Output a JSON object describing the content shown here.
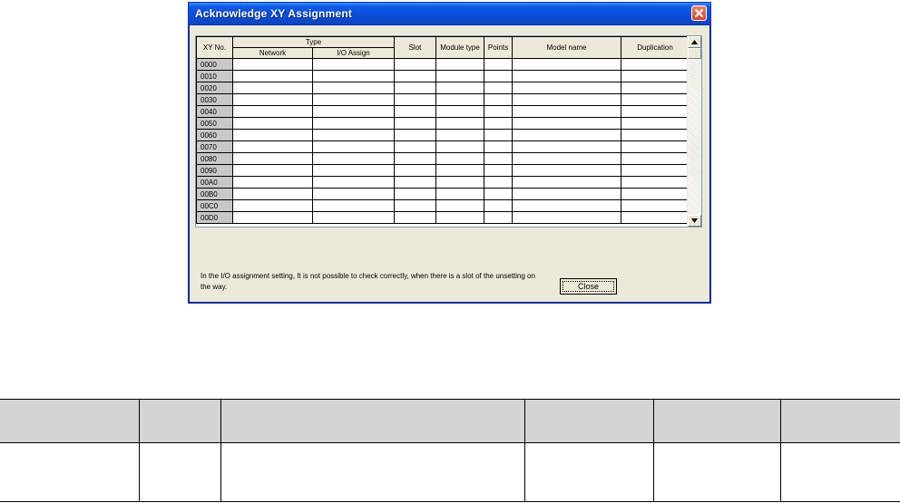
{
  "window": {
    "title": "Acknowledge XY Assignment"
  },
  "grid": {
    "headers": {
      "xy_no": "XY No.",
      "type": "Type",
      "network": "Network",
      "io_assign": "I/O Assign",
      "slot": "Slot",
      "module_type": "Module type",
      "points": "Points",
      "model_name": "Model name",
      "duplication": "Duplication"
    },
    "rows": [
      "0000",
      "0010",
      "0020",
      "0030",
      "0040",
      "0050",
      "0060",
      "0070",
      "0080",
      "0090",
      "00A0",
      "00B0",
      "00C0",
      "00D0"
    ]
  },
  "footer": {
    "message": "In the I/O assignment setting, It is not possible to check correctly, when there is a slot of the unsetting on the way.",
    "close_label": "Close"
  },
  "icons": {
    "close": "close-icon",
    "scroll_up": "scroll-up-arrow-icon",
    "scroll_down": "scroll-down-arrow-icon"
  }
}
